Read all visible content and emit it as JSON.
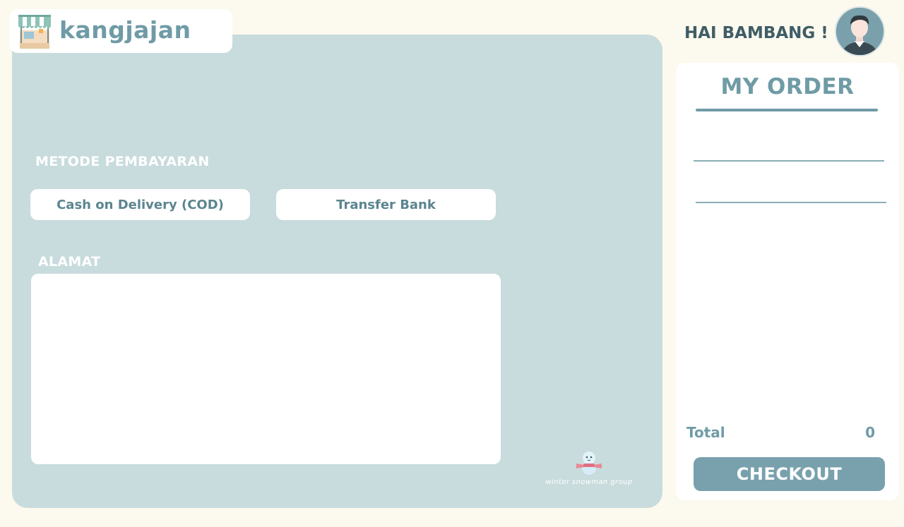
{
  "app": {
    "name": "kangjajan"
  },
  "header": {
    "greeting": "HAI BAMBANG !"
  },
  "payment": {
    "section_label": "METODE PEMBAYARAN",
    "options": [
      "Cash on Delivery (COD)",
      "Transfer Bank"
    ]
  },
  "address": {
    "section_label": "ALAMAT",
    "value": ""
  },
  "branding": {
    "watermark": "winter snowman group"
  },
  "order": {
    "title": "MY ORDER",
    "total_label": "Total",
    "total_value": "0",
    "checkout_label": "CHECKOUT"
  },
  "colors": {
    "background": "#fcf9ee",
    "panel": "#c8dbdd",
    "accent": "#6f9ba6",
    "button": "#78a1ad"
  }
}
